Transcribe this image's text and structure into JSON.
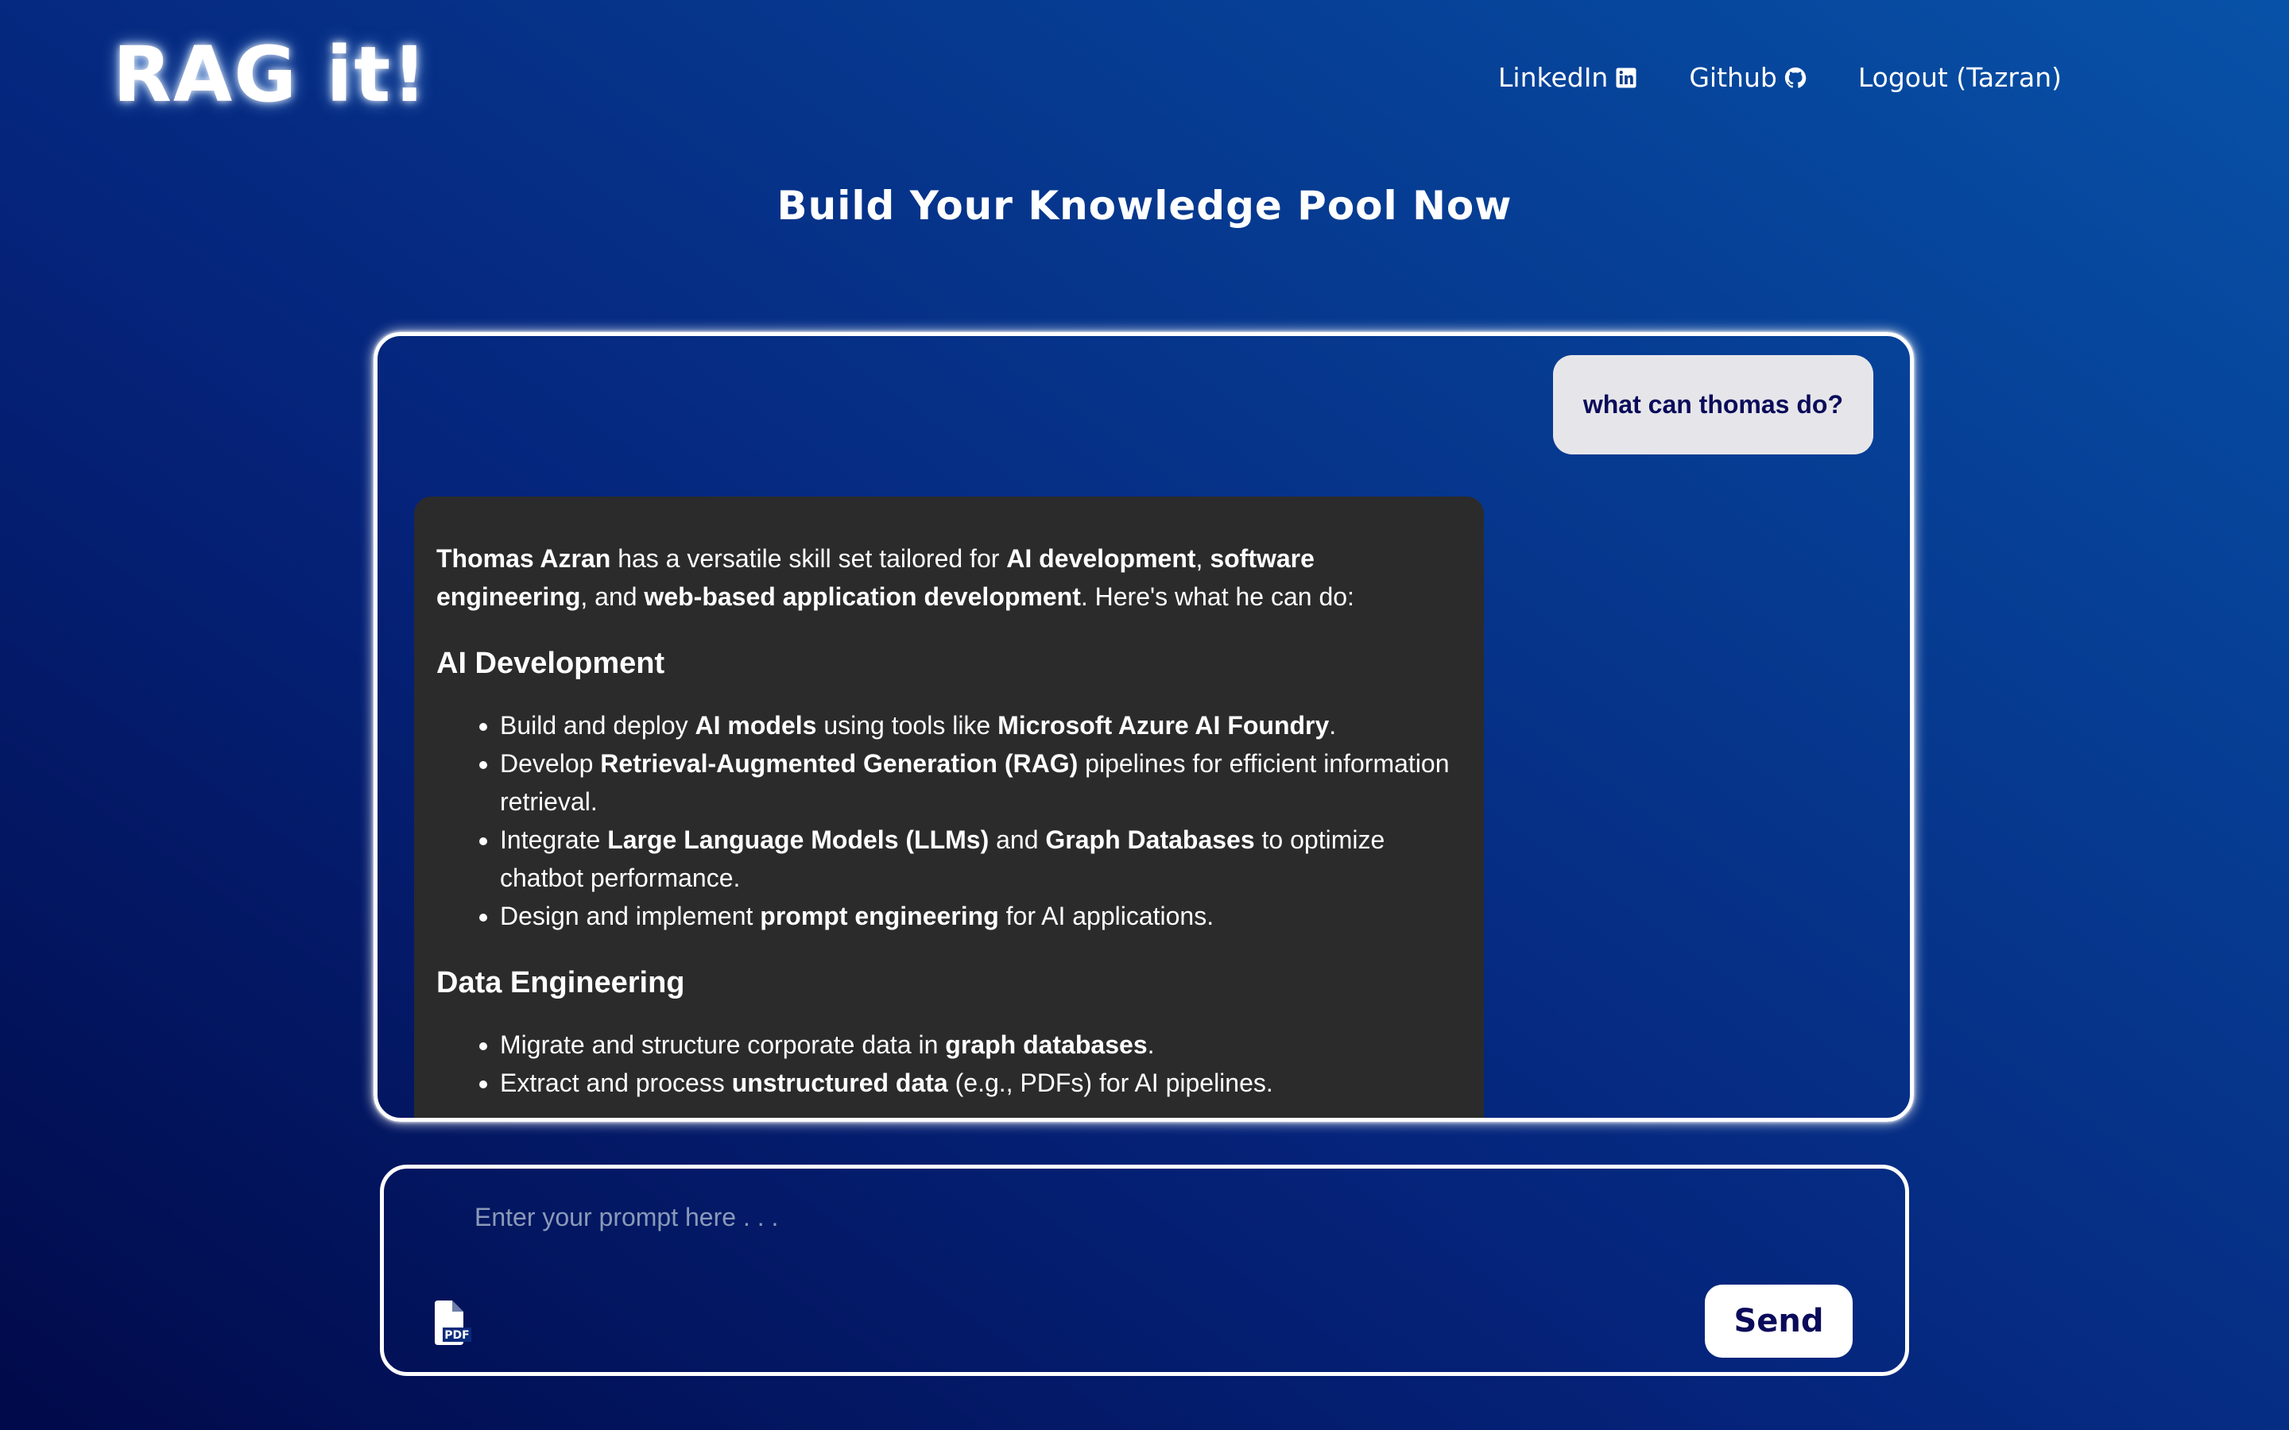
{
  "app": {
    "logo": "RAG it!"
  },
  "nav": {
    "items": [
      {
        "label": "LinkedIn",
        "icon": "linkedin-icon"
      },
      {
        "label": "Github",
        "icon": "github-icon"
      },
      {
        "label": "Logout (Tazran)"
      }
    ]
  },
  "page": {
    "heading": "Build Your Knowledge Pool Now"
  },
  "chat": {
    "user_message": "what can thomas do?",
    "bot_message": {
      "intro_runs": [
        {
          "text": "Thomas Azran",
          "bold": true
        },
        {
          "text": " has a versatile skill set tailored for ",
          "bold": false
        },
        {
          "text": "AI development",
          "bold": true
        },
        {
          "text": ", ",
          "bold": false
        },
        {
          "text": "software engineering",
          "bold": true
        },
        {
          "text": ", and ",
          "bold": false
        },
        {
          "text": "web-based application development",
          "bold": true
        },
        {
          "text": ". Here's what he can do:",
          "bold": false
        }
      ],
      "sections": [
        {
          "title": "AI Development",
          "items": [
            [
              {
                "text": "Build and deploy ",
                "bold": false
              },
              {
                "text": "AI models",
                "bold": true
              },
              {
                "text": " using tools like ",
                "bold": false
              },
              {
                "text": "Microsoft Azure AI Foundry",
                "bold": true
              },
              {
                "text": ".",
                "bold": false
              }
            ],
            [
              {
                "text": "Develop ",
                "bold": false
              },
              {
                "text": "Retrieval-Augmented Generation (RAG)",
                "bold": true
              },
              {
                "text": " pipelines for efficient information retrieval.",
                "bold": false
              }
            ],
            [
              {
                "text": "Integrate ",
                "bold": false
              },
              {
                "text": "Large Language Models (LLMs)",
                "bold": true
              },
              {
                "text": " and ",
                "bold": false
              },
              {
                "text": "Graph Databases",
                "bold": true
              },
              {
                "text": " to optimize chatbot performance.",
                "bold": false
              }
            ],
            [
              {
                "text": "Design and implement ",
                "bold": false
              },
              {
                "text": "prompt engineering",
                "bold": true
              },
              {
                "text": " for AI applications.",
                "bold": false
              }
            ]
          ]
        },
        {
          "title": "Data Engineering",
          "items": [
            [
              {
                "text": "Migrate and structure corporate data in ",
                "bold": false
              },
              {
                "text": "graph databases",
                "bold": true
              },
              {
                "text": ".",
                "bold": false
              }
            ],
            [
              {
                "text": "Extract and process ",
                "bold": false
              },
              {
                "text": "unstructured data",
                "bold": true
              },
              {
                "text": " (e.g., PDFs) for AI pipelines.",
                "bold": false
              }
            ]
          ]
        }
      ]
    }
  },
  "prompt": {
    "placeholder": "Enter your prompt here . . .",
    "value": "",
    "attach_icon": "pdf-file-icon",
    "attach_icon_text": "PDF",
    "send_label": "Send"
  },
  "colors": {
    "background_dark": "#010a4a",
    "background_light": "#0752a8",
    "bot_bubble": "#2b2b2b",
    "user_bubble": "#e6e6ea",
    "user_text": "#0b0b5a"
  }
}
